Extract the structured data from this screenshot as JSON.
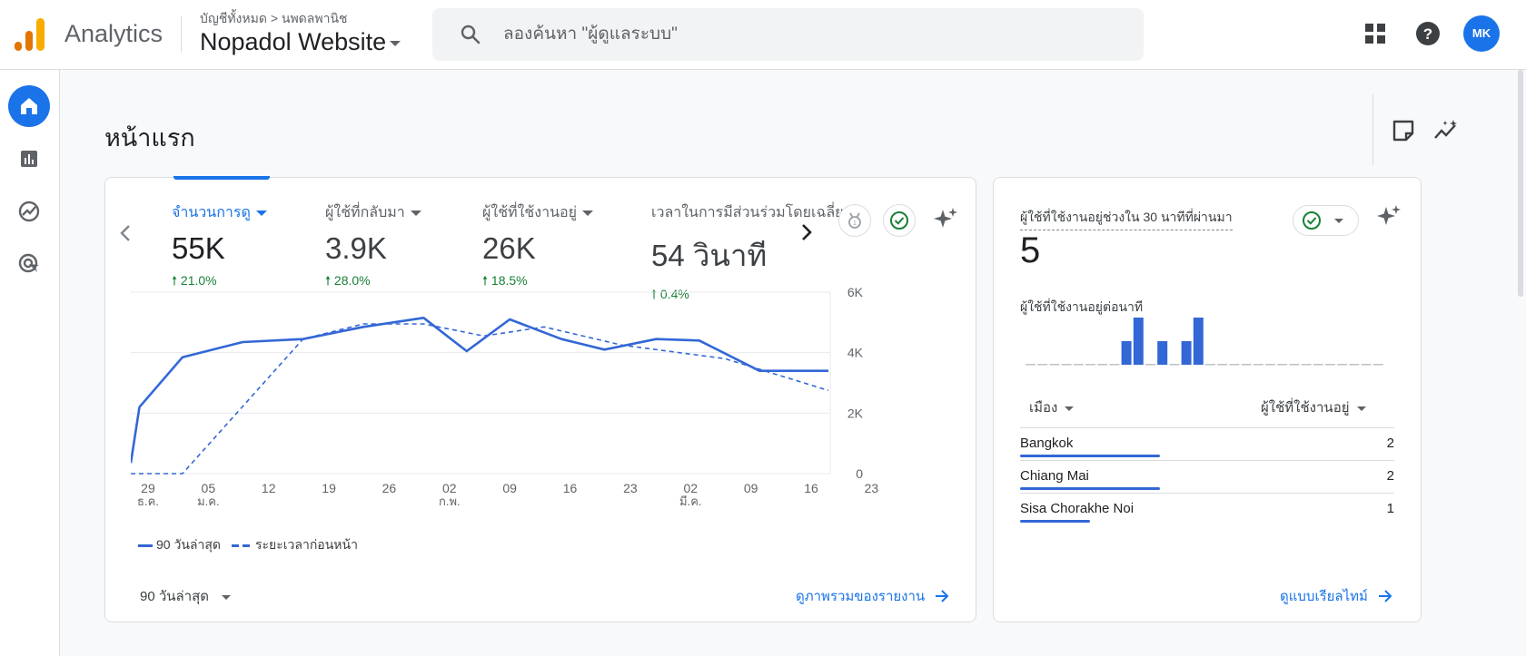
{
  "header": {
    "app_name": "Analytics",
    "breadcrumb": "บัญชีทั้งหมด > นพดลพานิช",
    "property": "Nopadol Website",
    "search_placeholder": "ลองค้นหา \"ผู้ดูแลระบบ\"",
    "avatar_initials": "MK"
  },
  "page": {
    "title": "หน้าแรก"
  },
  "summary_card": {
    "metrics": [
      {
        "label": "จำนวนการดู",
        "value": "55K",
        "change": "21.0%",
        "selected": true
      },
      {
        "label": "ผู้ใช้ที่กลับมา",
        "value": "3.9K",
        "change": "28.0%"
      },
      {
        "label": "ผู้ใช้ที่ใช้งานอยู่",
        "value": "26K",
        "change": "18.5%"
      },
      {
        "label": "เวลาในการมีส่วนร่วมโดยเฉลี่ย",
        "value": "54 วินาที",
        "change": "0.4%"
      }
    ],
    "legend": {
      "current": "90 วันล่าสุด",
      "previous": "ระยะเวลาก่อนหน้า"
    },
    "date_range": "90 วันล่าสุด",
    "view_report_link": "ดูภาพรวมของรายงาน"
  },
  "chart_data": {
    "type": "line",
    "ylim": [
      0,
      6000
    ],
    "y_ticks": [
      "6K",
      "4K",
      "2K",
      "0"
    ],
    "x_ticks": [
      {
        "label": "29",
        "sub": "ธ.ค."
      },
      {
        "label": "05",
        "sub": "ม.ค."
      },
      {
        "label": "12",
        "sub": ""
      },
      {
        "label": "19",
        "sub": ""
      },
      {
        "label": "26",
        "sub": ""
      },
      {
        "label": "02",
        "sub": "ก.พ."
      },
      {
        "label": "09",
        "sub": ""
      },
      {
        "label": "16",
        "sub": ""
      },
      {
        "label": "23",
        "sub": ""
      },
      {
        "label": "02",
        "sub": "มี.ค."
      },
      {
        "label": "09",
        "sub": ""
      },
      {
        "label": "16",
        "sub": ""
      },
      {
        "label": "23",
        "sub": ""
      }
    ],
    "series": [
      {
        "name": "90 วันล่าสุด",
        "style": "solid",
        "x": [
          27,
          28,
          33,
          40,
          47,
          54,
          61,
          66,
          71,
          77,
          82,
          88,
          93,
          100,
          107,
          108
        ],
        "values": [
          350,
          2200,
          3850,
          4350,
          4450,
          4850,
          5150,
          4050,
          5100,
          4450,
          4100,
          4450,
          4400,
          3400,
          3400,
          3400
        ]
      },
      {
        "name": "ระยะเวลาก่อนหน้า",
        "style": "dashed",
        "x": [
          27,
          33,
          47,
          54,
          61,
          68,
          75,
          84,
          96,
          108
        ],
        "values": [
          0,
          0,
          4450,
          4950,
          4950,
          4550,
          4850,
          4250,
          3800,
          2750
        ]
      }
    ],
    "grid": true
  },
  "realtime_card": {
    "label": "ผู้ใช้ที่ใช้งานอยู่ช่วงใน 30 นาทีที่ผ่านมา",
    "value": "5",
    "per_minute_label": "ผู้ใช้ที่ใช้งานอยู่ต่อนาที",
    "per_minute_values": [
      0,
      0,
      0,
      0,
      0,
      0,
      0,
      0,
      1,
      2,
      0,
      1,
      0,
      1,
      2,
      0,
      0,
      0,
      0,
      0,
      0,
      0,
      0,
      0,
      0,
      0,
      0,
      0,
      0,
      0
    ],
    "col_city": "เมือง",
    "col_users": "ผู้ใช้ที่ใช้งานอยู่",
    "rows": [
      {
        "city": "Bangkok",
        "count": "2",
        "share": 0.4
      },
      {
        "city": "Chiang Mai",
        "count": "2",
        "share": 0.4
      },
      {
        "city": "Sisa Chorakhe Noi",
        "count": "1",
        "share": 0.2
      }
    ],
    "realtime_link": "ดูแบบเรียลไทม์"
  },
  "colors": {
    "accent": "#1a73e8",
    "line": "#3367d6",
    "positive": "#188038"
  }
}
